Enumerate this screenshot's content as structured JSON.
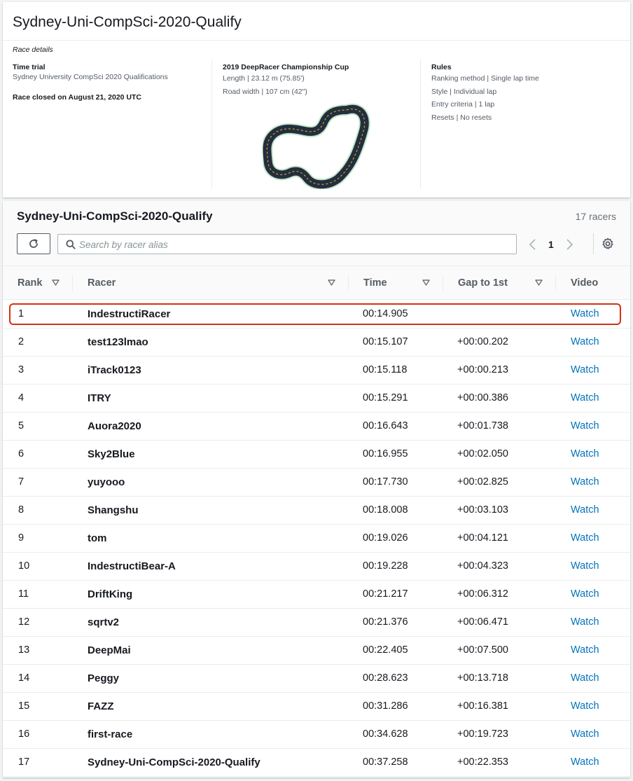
{
  "details": {
    "title": "Sydney-Uni-CompSci-2020-Qualify",
    "subtitle": "Race details",
    "race_type": {
      "heading": "Time trial",
      "description": "Sydney University CompSci 2020 Qualifications",
      "closed_text": "Race closed on August 21, 2020 UTC"
    },
    "track": {
      "heading": "2019 DeepRacer Championship Cup",
      "length": "Length | 23.12 m (75.85')",
      "road_width": "Road width | 107 cm (42\")"
    },
    "rules": {
      "heading": "Rules",
      "items": [
        "Ranking method | Single lap time",
        "Style | Individual lap",
        "Entry criteria | 1 lap",
        "Resets | No resets"
      ]
    }
  },
  "board": {
    "title": "Sydney-Uni-CompSci-2020-Qualify",
    "racer_count": "17 racers",
    "search_placeholder": "Search by racer alias",
    "page": "1",
    "columns": {
      "rank": "Rank",
      "racer": "Racer",
      "time": "Time",
      "gap": "Gap to 1st",
      "video": "Video"
    },
    "watch_label": "Watch",
    "rows": [
      {
        "rank": "1",
        "racer": "IndestructiRacer",
        "time": "00:14.905",
        "gap": ""
      },
      {
        "rank": "2",
        "racer": "test123lmao",
        "time": "00:15.107",
        "gap": "+00:00.202"
      },
      {
        "rank": "3",
        "racer": "iTrack0123",
        "time": "00:15.118",
        "gap": "+00:00.213"
      },
      {
        "rank": "4",
        "racer": "ITRY",
        "time": "00:15.291",
        "gap": "+00:00.386"
      },
      {
        "rank": "5",
        "racer": "Auora2020",
        "time": "00:16.643",
        "gap": "+00:01.738"
      },
      {
        "rank": "6",
        "racer": "Sky2Blue",
        "time": "00:16.955",
        "gap": "+00:02.050"
      },
      {
        "rank": "7",
        "racer": "yuyooo",
        "time": "00:17.730",
        "gap": "+00:02.825"
      },
      {
        "rank": "8",
        "racer": "Shangshu",
        "time": "00:18.008",
        "gap": "+00:03.103"
      },
      {
        "rank": "9",
        "racer": "tom",
        "time": "00:19.026",
        "gap": "+00:04.121"
      },
      {
        "rank": "10",
        "racer": "IndestructiBear-A",
        "time": "00:19.228",
        "gap": "+00:04.323"
      },
      {
        "rank": "11",
        "racer": "DriftKing",
        "time": "00:21.217",
        "gap": "+00:06.312"
      },
      {
        "rank": "12",
        "racer": "sqrtv2",
        "time": "00:21.376",
        "gap": "+00:06.471"
      },
      {
        "rank": "13",
        "racer": "DeepMai",
        "time": "00:22.405",
        "gap": "+00:07.500"
      },
      {
        "rank": "14",
        "racer": "Peggy",
        "time": "00:28.623",
        "gap": "+00:13.718"
      },
      {
        "rank": "15",
        "racer": "FAZZ",
        "time": "00:31.286",
        "gap": "+00:16.381"
      },
      {
        "rank": "16",
        "racer": "first-race",
        "time": "00:34.628",
        "gap": "+00:19.723"
      },
      {
        "rank": "17",
        "racer": "Sydney-Uni-CompSci-2020-Qualify",
        "time": "00:37.258",
        "gap": "+00:22.353"
      }
    ]
  },
  "colors": {
    "link": "#0073bb",
    "highlight_border": "#d13212",
    "track_fill": "#232f3e",
    "track_edge": "#c3e6cb",
    "track_center": "#f2b12b"
  },
  "icons": {
    "refresh": "refresh-icon",
    "search": "search-icon",
    "prev": "chevron-left-icon",
    "next": "chevron-right-icon",
    "settings": "gear-icon",
    "sort": "caret-down-icon"
  }
}
